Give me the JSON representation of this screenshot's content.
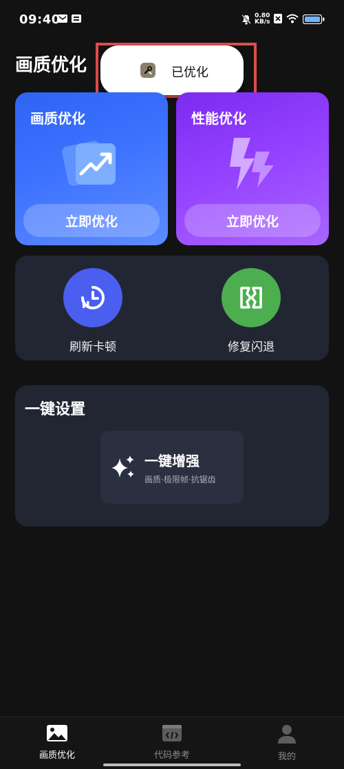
{
  "status": {
    "time": "09:40",
    "net_speed_top": "0.80",
    "net_speed_bottom": "KB/s"
  },
  "header": {
    "title": "画质优化"
  },
  "toast": {
    "text": "已优化",
    "icon": "wrench-app-icon"
  },
  "cards": [
    {
      "title": "画质优化",
      "button": "立即优化",
      "icon": "trend-chart-icon"
    },
    {
      "title": "性能优化",
      "button": "立即优化",
      "icon": "lightning-icon"
    }
  ],
  "tools": [
    {
      "label": "刷新卡顿",
      "icon": "clock-icon",
      "color": "#4a5ff0"
    },
    {
      "label": "修复闪退",
      "icon": "repair-icon",
      "color": "#4cae4e"
    }
  ],
  "setup": {
    "title": "一键设置",
    "enhance_title": "一键增强",
    "enhance_sub": "画质·极限帧·抗锯齿"
  },
  "nav": [
    {
      "label": "画质优化",
      "icon": "image-icon",
      "active": true
    },
    {
      "label": "代码参考",
      "icon": "code-icon",
      "active": false
    },
    {
      "label": "我的",
      "icon": "user-icon",
      "active": false
    }
  ],
  "colors": {
    "accent_blue": "#3d72ff",
    "accent_purple": "#9440ff",
    "panel": "#222633",
    "background": "#121212"
  }
}
